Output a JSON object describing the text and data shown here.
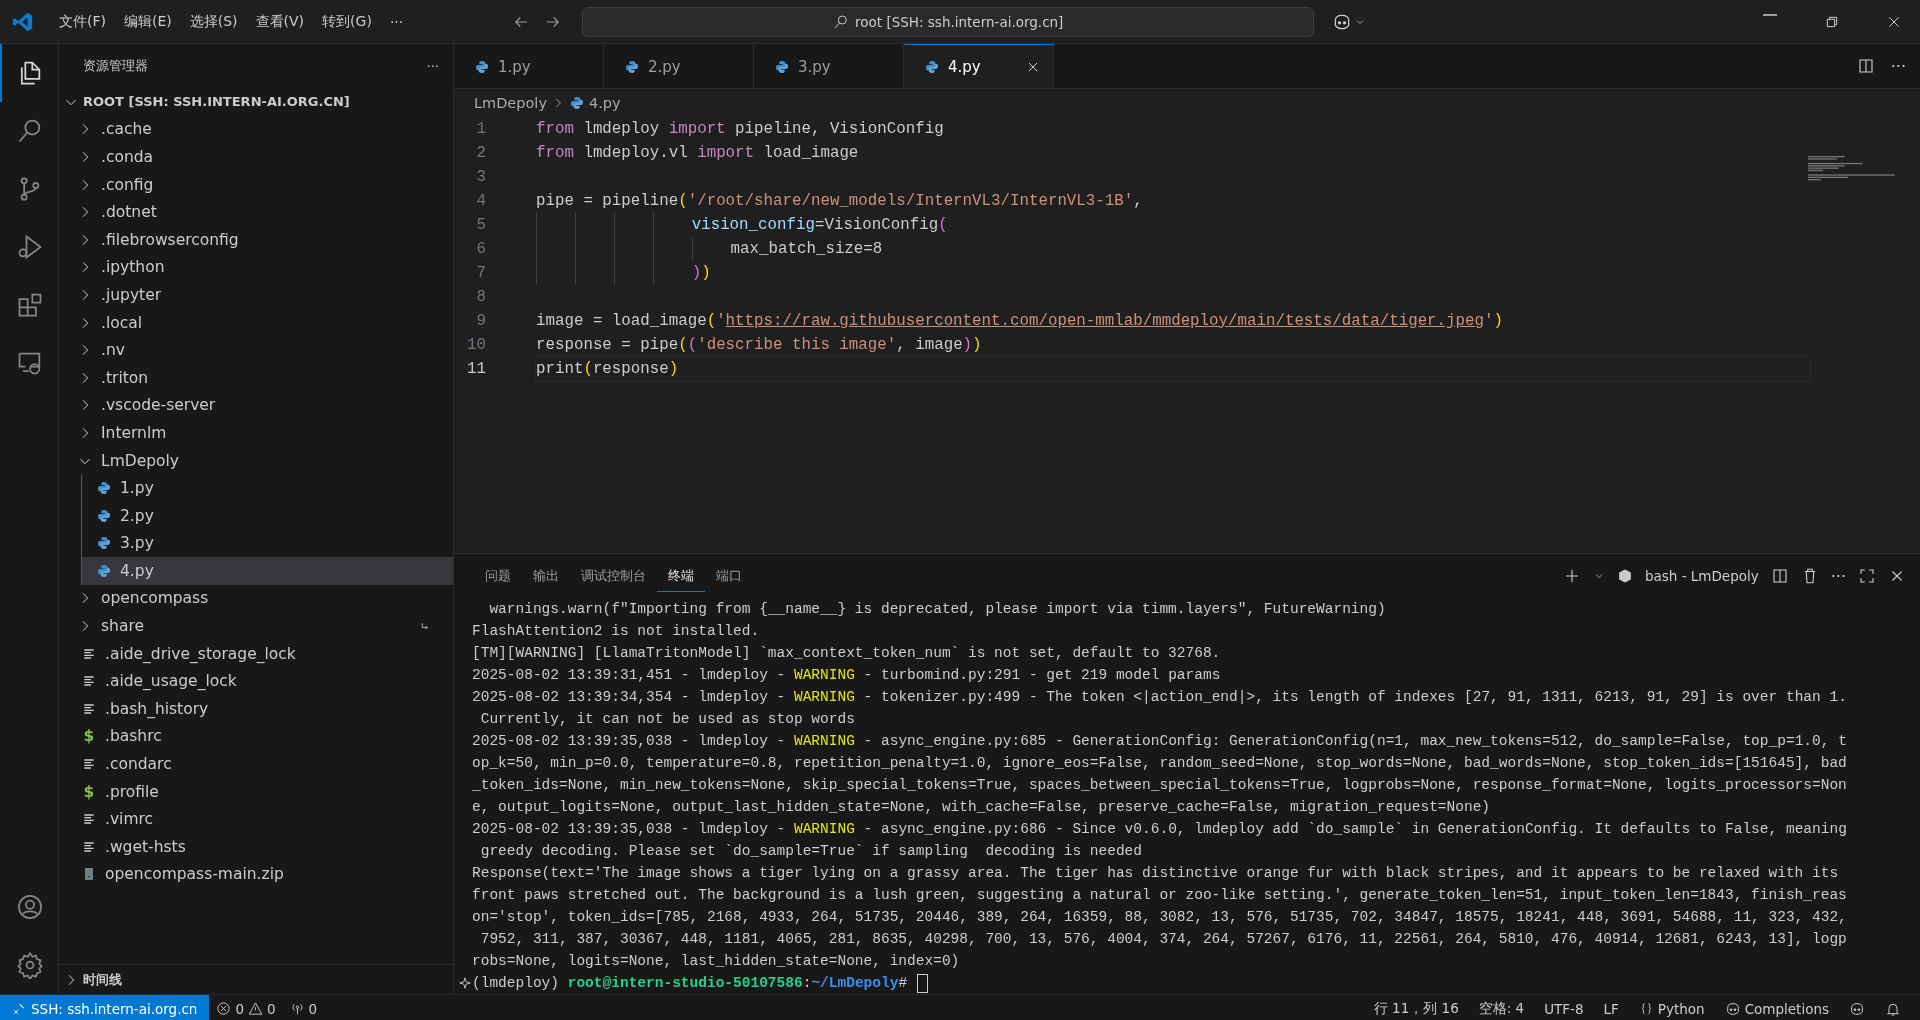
{
  "title_bar": {
    "menu": [
      "文件(F)",
      "编辑(E)",
      "选择(S)",
      "查看(V)",
      "转到(G)",
      "···"
    ],
    "search": "root [SSH: ssh.intern-ai.org.cn]"
  },
  "activity_bar": [
    {
      "kind": "explorer",
      "selected": true
    },
    {
      "kind": "search",
      "selected": false
    },
    {
      "kind": "source-control",
      "selected": false
    },
    {
      "kind": "run",
      "selected": false
    },
    {
      "kind": "extensions",
      "selected": false
    },
    {
      "kind": "remote",
      "selected": false
    }
  ],
  "sidebar": {
    "title": "资源管理器",
    "more": "···",
    "root": {
      "label": "ROOT [SSH: SSH.INTERN-AI.ORG.CN]",
      "expanded": true
    },
    "items": [
      {
        "label": ".cache",
        "kind": "folder",
        "expanded": false,
        "selected": false
      },
      {
        "label": ".conda",
        "kind": "folder",
        "expanded": false,
        "selected": false
      },
      {
        "label": ".config",
        "kind": "folder",
        "expanded": false,
        "selected": false
      },
      {
        "label": ".dotnet",
        "kind": "folder",
        "expanded": false,
        "selected": false
      },
      {
        "label": ".filebrowserconfig",
        "kind": "folder",
        "expanded": false,
        "selected": false
      },
      {
        "label": ".ipython",
        "kind": "folder",
        "expanded": false,
        "selected": false
      },
      {
        "label": ".jupyter",
        "kind": "folder",
        "expanded": false,
        "selected": false
      },
      {
        "label": ".local",
        "kind": "folder",
        "expanded": false,
        "selected": false
      },
      {
        "label": ".nv",
        "kind": "folder",
        "expanded": false,
        "selected": false
      },
      {
        "label": ".triton",
        "kind": "folder",
        "expanded": false,
        "selected": false
      },
      {
        "label": ".vscode-server",
        "kind": "folder",
        "expanded": false,
        "selected": false
      },
      {
        "label": "Internlm",
        "kind": "folder",
        "expanded": false,
        "selected": false
      },
      {
        "label": "LmDepoly",
        "kind": "folder",
        "expanded": true,
        "selected": false,
        "children": [
          {
            "label": "1.py",
            "kind": "python",
            "selected": false
          },
          {
            "label": "2.py",
            "kind": "python",
            "selected": false
          },
          {
            "label": "3.py",
            "kind": "python",
            "selected": false
          },
          {
            "label": "4.py",
            "kind": "python",
            "selected": true
          }
        ]
      },
      {
        "label": "opencompass",
        "kind": "folder",
        "expanded": false,
        "selected": false
      },
      {
        "label": "share",
        "kind": "folder-link",
        "expanded": false,
        "selected": false
      },
      {
        "label": ".aide_drive_storage_lock",
        "kind": "text",
        "selected": false
      },
      {
        "label": ".aide_usage_lock",
        "kind": "text",
        "selected": false
      },
      {
        "label": ".bash_history",
        "kind": "text",
        "selected": false
      },
      {
        "label": ".bashrc",
        "kind": "shell",
        "icon": "$",
        "selected": false
      },
      {
        "label": ".condarc",
        "kind": "text",
        "selected": false
      },
      {
        "label": ".profile",
        "kind": "shell",
        "icon": "$",
        "selected": false
      },
      {
        "label": ".vimrc",
        "kind": "text",
        "selected": false
      },
      {
        "label": ".wget-hsts",
        "kind": "text",
        "selected": false
      },
      {
        "label": "opencompass-main.zip",
        "kind": "zip",
        "selected": false
      }
    ],
    "timeline": {
      "label": "时间线",
      "expanded": false
    }
  },
  "editor": {
    "tabs": [
      {
        "label": "1.py",
        "selected": false
      },
      {
        "label": "2.py",
        "selected": false
      },
      {
        "label": "3.py",
        "selected": false
      },
      {
        "label": "4.py",
        "selected": true
      }
    ],
    "more": "···",
    "breadcrumb": [
      "LmDepoly",
      "4.py"
    ],
    "lines": [
      {
        "number": "1",
        "current": false,
        "tokens": [
          {
            "kind": "keyword",
            "t": "from"
          },
          {
            "kind": "plain",
            "t": " lmdeploy "
          },
          {
            "kind": "keyword",
            "t": "import"
          },
          {
            "kind": "plain",
            "t": " pipeline, VisionConfig"
          }
        ]
      },
      {
        "number": "2",
        "current": false,
        "tokens": [
          {
            "kind": "keyword",
            "t": "from"
          },
          {
            "kind": "plain",
            "t": " lmdeploy.vl "
          },
          {
            "kind": "keyword",
            "t": "import"
          },
          {
            "kind": "plain",
            "t": " load_image"
          }
        ]
      },
      {
        "number": "3",
        "current": false
      },
      {
        "number": "4",
        "current": false,
        "tokens": [
          {
            "kind": "plain",
            "t": "pipe = pipeline"
          },
          {
            "kind": "bracket1",
            "t": "("
          },
          {
            "kind": "string",
            "t": "'/root/share/new_models/InternVL3/InternVL3-1B'"
          },
          {
            "kind": "plain",
            "t": ","
          }
        ]
      },
      {
        "number": "5",
        "current": false,
        "tokens": [
          {
            "kind": "variable",
            "t": "                vision_config"
          },
          {
            "kind": "plain",
            "t": "=VisionConfig"
          },
          {
            "kind": "bracket2",
            "t": "("
          }
        ]
      },
      {
        "number": "6",
        "current": false,
        "tokens": [
          {
            "kind": "plain",
            "t": "                    max_batch_size=8"
          }
        ]
      },
      {
        "number": "7",
        "current": false,
        "tokens": [
          {
            "kind": "bracket2",
            "t": "                )"
          },
          {
            "kind": "bracket1",
            "t": ")"
          }
        ]
      },
      {
        "number": "8",
        "current": false
      },
      {
        "number": "9",
        "current": false,
        "tokens": [
          {
            "kind": "plain",
            "t": "image = load_image"
          },
          {
            "kind": "bracket1",
            "t": "("
          },
          {
            "kind": "string",
            "t": "'"
          },
          {
            "kind": "link",
            "t": "https://raw.githubusercontent.com/open-mmlab/mmdeploy/main/tests/data/tiger.jpeg"
          },
          {
            "kind": "string",
            "t": "'"
          },
          {
            "kind": "bracket1",
            "t": ")"
          }
        ]
      },
      {
        "number": "10",
        "current": false,
        "tokens": [
          {
            "kind": "plain",
            "t": "response = pipe"
          },
          {
            "kind": "bracket1",
            "t": "("
          },
          {
            "kind": "bracket2",
            "t": "("
          },
          {
            "kind": "string",
            "t": "'describe this image'"
          },
          {
            "kind": "plain",
            "t": ", image"
          },
          {
            "kind": "bracket2",
            "t": ")"
          },
          {
            "kind": "bracket1",
            "t": ")"
          }
        ]
      },
      {
        "number": "11",
        "current": true,
        "tokens": [
          {
            "kind": "plain",
            "t": "print"
          },
          {
            "kind": "bracket1",
            "t": "("
          },
          {
            "kind": "plain",
            "t": "response"
          },
          {
            "kind": "bracket1",
            "t": ")"
          }
        ]
      }
    ]
  },
  "panel": {
    "tabs": [
      {
        "label": "问题",
        "selected": false
      },
      {
        "label": "输出",
        "selected": false
      },
      {
        "label": "调试控制台",
        "selected": false
      },
      {
        "label": "终端",
        "selected": true
      },
      {
        "label": "端口",
        "selected": false
      }
    ],
    "terminal_name": "bash - LmDepoly",
    "more": "···",
    "lines": [
      [
        {
          "kind": "text",
          "t": "  warnings.warn(f\"Importing from {__name__} is deprecated, please import via timm.layers\", FutureWarning)"
        }
      ],
      [
        {
          "kind": "text",
          "t": "FlashAttention2 is not installed."
        }
      ],
      [
        {
          "kind": "text",
          "t": "[TM][WARNING] [LlamaTritonModel] `max_context_token_num` is not set, default to 32768."
        }
      ],
      [
        {
          "kind": "text",
          "t": "2025-08-02 13:39:31,451 - lmdeploy - "
        },
        {
          "kind": "warning",
          "t": "WARNING"
        },
        {
          "kind": "text",
          "t": " - turbomind.py:291 - get 219 model params"
        }
      ],
      [
        {
          "kind": "text",
          "t": "2025-08-02 13:39:34,354 - lmdeploy - "
        },
        {
          "kind": "warning",
          "t": "WARNING"
        },
        {
          "kind": "text",
          "t": " - tokenizer.py:499 - The token <|action_end|>, its length of indexes [27, 91, 1311, 6213, 91, 29] is over than 1."
        }
      ],
      [
        {
          "kind": "text",
          "t": " Currently, it can not be used as stop words"
        }
      ],
      [
        {
          "kind": "text",
          "t": "2025-08-02 13:39:35,038 - lmdeploy - "
        },
        {
          "kind": "warning",
          "t": "WARNING"
        },
        {
          "kind": "text",
          "t": " - async_engine.py:685 - GenerationConfig: GenerationConfig(n=1, max_new_tokens=512, do_sample=False, top_p=1.0, t"
        }
      ],
      [
        {
          "kind": "text",
          "t": "op_k=50, min_p=0.0, temperature=0.8, repetition_penalty=1.0, ignore_eos=False, random_seed=None, stop_words=None, bad_words=None, stop_token_ids=[151645], bad"
        }
      ],
      [
        {
          "kind": "text",
          "t": "_token_ids=None, min_new_tokens=None, skip_special_tokens=True, spaces_between_special_tokens=True, logprobs=None, response_format=None, logits_processors=Non"
        }
      ],
      [
        {
          "kind": "text",
          "t": "e, output_logits=None, output_last_hidden_state=None, with_cache=False, preserve_cache=False, migration_request=None)"
        }
      ],
      [
        {
          "kind": "text",
          "t": "2025-08-02 13:39:35,038 - lmdeploy - "
        },
        {
          "kind": "warning",
          "t": "WARNING"
        },
        {
          "kind": "text",
          "t": " - async_engine.py:686 - Since v0.6.0, lmdeploy add `do_sample` in GenerationConfig. It defaults to False, meaning"
        }
      ],
      [
        {
          "kind": "text",
          "t": " greedy decoding. Please set `do_sample=True` if sampling  decoding is needed"
        }
      ],
      [
        {
          "kind": "text",
          "t": "Response(text='The image shows a tiger lying on a grassy area. The tiger has distinctive orange fur with black stripes, and it appears to be relaxed with its"
        }
      ],
      [
        {
          "kind": "text",
          "t": "front paws stretched out. The background is a lush green, suggesting a natural or zoo-like setting.', generate_token_len=51, input_token_len=1843, finish_reas"
        }
      ],
      [
        {
          "kind": "text",
          "t": "on='stop', token_ids=[785, 2168, 4933, 264, 51735, 20446, 389, 264, 16359, 88, 3082, 13, 576, 51735, 702, 34847, 18575, 18241, 448, 3691, 54688, 11, 323, 432,"
        }
      ],
      [
        {
          "kind": "text",
          "t": " 7952, 311, 387, 30367, 448, 1181, 4065, 281, 8635, 40298, 700, 13, 576, 4004, 374, 264, 57267, 6176, 11, 22561, 264, 5810, 476, 40914, 12681, 6243, 13], logp"
        }
      ],
      [
        {
          "kind": "text",
          "t": "robs=None, logits=None, last_hidden_state=None, index=0)"
        }
      ]
    ],
    "prompt": [
      {
        "kind": "text",
        "t": "(lmdeploy) "
      },
      {
        "kind": "user",
        "t": "root@intern-studio-50107586"
      },
      {
        "kind": "text",
        "t": ":"
      },
      {
        "kind": "path",
        "t": "~/LmDepoly"
      },
      {
        "kind": "text",
        "t": "# "
      }
    ]
  },
  "status_bar": {
    "remote": "SSH: ssh.intern-ai.org.cn",
    "errors": "0",
    "warnings": "0",
    "ports": "0",
    "right": [
      {
        "kind": "text",
        "label": "行 11，列 16"
      },
      {
        "kind": "text",
        "label": "空格: 4"
      },
      {
        "kind": "text",
        "label": "UTF-8"
      },
      {
        "kind": "text",
        "label": "LF"
      },
      {
        "kind": "braces",
        "label": "Python"
      },
      {
        "kind": "copilot",
        "label": "Completions"
      },
      {
        "kind": "copilot-icon"
      },
      {
        "kind": "bell"
      }
    ]
  }
}
